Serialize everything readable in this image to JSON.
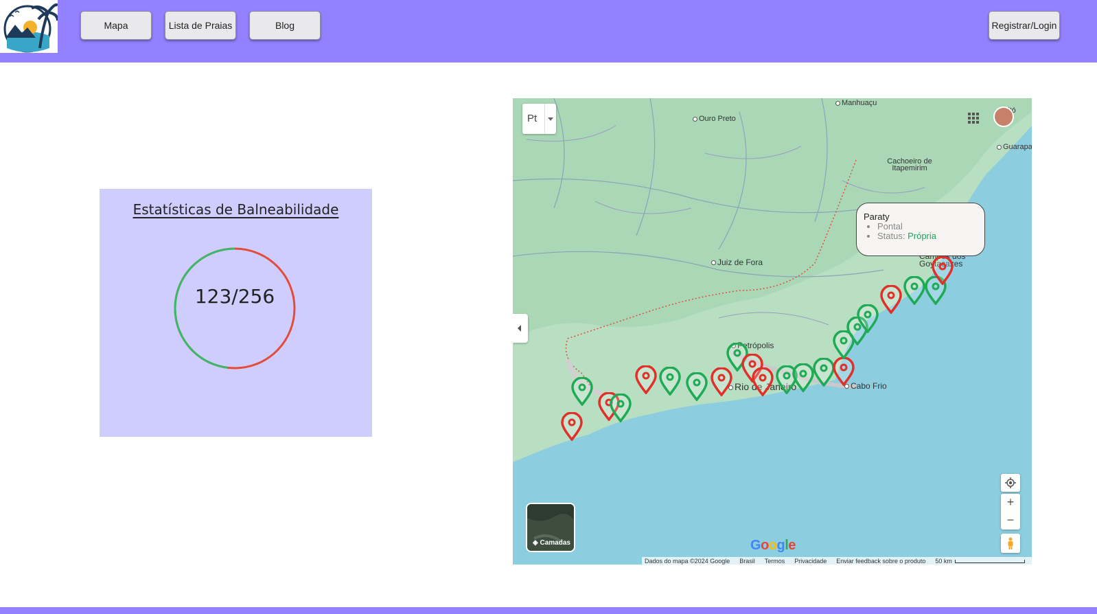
{
  "header": {
    "nav": [
      "Mapa",
      "Lista de Praias",
      "Blog"
    ],
    "login_label": "Registrar/Login"
  },
  "stats": {
    "title": "Estatísticas de Balneabilidade",
    "value_text": "123/256",
    "good": 123,
    "total": 256,
    "colors": {
      "good": "#3cb866",
      "bad": "#e34b3a",
      "panel": "#cfcdfd"
    }
  },
  "map": {
    "language_button": "Pt",
    "places": {
      "manhuacu": "Manhuaçu",
      "ouro_preto": "Ouro Preto",
      "vitoria": "Vitó",
      "guarapari": "Guarapa",
      "cachoeiro": "Cachoeiro de Itapemirim",
      "juiz_de_fora": "Juiz de Fora",
      "campos": "Campos dos Goytacazes",
      "petropolis": "Petrópolis",
      "rio": "Rio de Janeiro",
      "cabo_frio": "Cabo Frio"
    },
    "tooltip": {
      "title": "Paraty",
      "items": [
        "Pontal",
        "Status:"
      ],
      "status_value": "Própria"
    },
    "layers_label": "Camadas",
    "google_logo": "Google",
    "zoom_in": "+",
    "zoom_out": "−",
    "attribution": {
      "data": "Dados do mapa ©2024 Google",
      "country": "Brasil",
      "terms": "Termos",
      "privacy": "Privacidade",
      "feedback": "Enviar feedback sobre o produto",
      "scale": "50 km"
    },
    "icons": [
      "language-dropdown-icon",
      "apps-grid-icon",
      "avatar",
      "collapse-icon",
      "layers-icon",
      "my-location-icon",
      "pegman-icon"
    ]
  }
}
